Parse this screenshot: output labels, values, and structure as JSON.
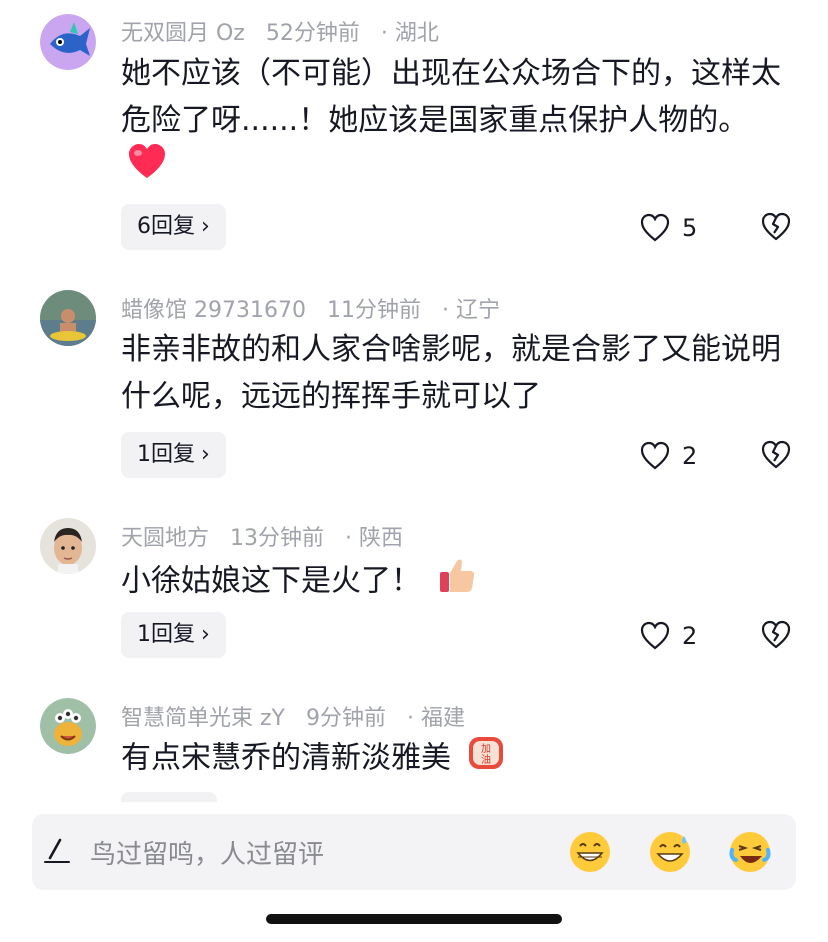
{
  "comments": [
    {
      "username": "无双圆月 Oz",
      "time": "52分钟前",
      "location": "· 湖北",
      "text": "她不应该（不可能）出现在公众场合下的，这样太危险了呀......！她应该是国家重点保护人物的。",
      "inline_emoji": "red-heart",
      "replies": "6回复",
      "likes": "5"
    },
    {
      "username": "蜡像馆 29731670",
      "time": "11分钟前",
      "location": "· 辽宁",
      "text": "非亲非故的和人家合啥影呢，就是合影了又能说明什么呢，远远的挥挥手就可以了",
      "replies": "1回复",
      "likes": "2"
    },
    {
      "username": "天圆地方",
      "time": "13分钟前",
      "location": "· 陕西",
      "text": "小徐姑娘这下是火了！",
      "inline_emoji": "thumbs-up",
      "replies": "1回复",
      "likes": "2"
    },
    {
      "username": "智慧简单光束 zY",
      "time": "9分钟前",
      "location": "· 福建",
      "text": "有点宋慧乔的清新淡雅美",
      "inline_emoji": "jiayou-sticker",
      "inline_emoji_text": "加油"
    }
  ],
  "input_bar": {
    "placeholder": "鸟过留鸣，人过留评"
  },
  "colors": {
    "meta_gray": "#a0a3ab",
    "pill_bg": "#f2f2f4",
    "heart_red": "#fe2c55",
    "emoji_yellow": "#ffcb3b"
  }
}
